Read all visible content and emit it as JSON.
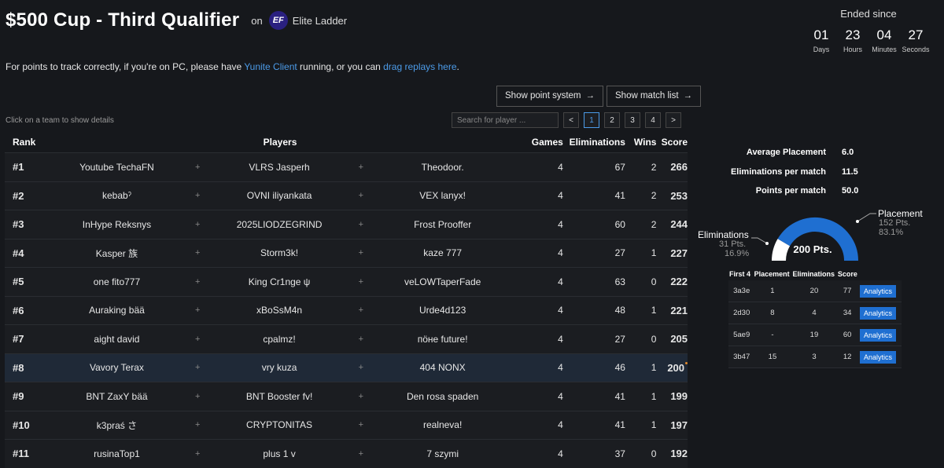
{
  "header": {
    "title": "$500 Cup - Third Qualifier",
    "on": "on",
    "ladder_logo": "EF",
    "ladder_name": "Elite Ladder"
  },
  "timer": {
    "title": "Ended since",
    "days": "01",
    "days_label": "Days",
    "hours": "23",
    "hours_label": "Hours",
    "minutes": "04",
    "minutes_label": "Minutes",
    "seconds": "27",
    "seconds_label": "Seconds"
  },
  "notice": {
    "part1": "For points to track correctly, if you're on PC, please have ",
    "link1": "Yunite Client",
    "part2": " running, or you can ",
    "link2": "drag replays here",
    "part3": "."
  },
  "buttons": {
    "point_system": "Show point system",
    "match_list": "Show match list"
  },
  "hint": "Click on a team to show details",
  "search": {
    "placeholder": "Search for player ..."
  },
  "pager": {
    "prev": "<",
    "next": ">",
    "pages": [
      "1",
      "2",
      "3",
      "4"
    ]
  },
  "table": {
    "headers": {
      "rank": "Rank",
      "players": "Players",
      "games": "Games",
      "elims": "Eliminations",
      "wins": "Wins",
      "score": "Score"
    },
    "plus": "+",
    "rows": [
      {
        "rank": "#1",
        "p1": "Youtube TechaFN",
        "p2": "VLRS Jasperh",
        "p3": "Theodoor.",
        "games": "4",
        "elims": "67",
        "wins": "2",
        "score": "266"
      },
      {
        "rank": "#2",
        "p1": "kebabˀ",
        "p2": "OVNI iliyankata",
        "p3": "VEX lanyx!",
        "games": "4",
        "elims": "41",
        "wins": "2",
        "score": "253"
      },
      {
        "rank": "#3",
        "p1": "InHype Reksnys",
        "p2": "2025LIODZEGRIND",
        "p3": "Frost Prooffer",
        "games": "4",
        "elims": "60",
        "wins": "2",
        "score": "244"
      },
      {
        "rank": "#4",
        "p1": "Kasper 族",
        "p2": "Storm3k!",
        "p3": "kaze 777",
        "games": "4",
        "elims": "27",
        "wins": "1",
        "score": "227"
      },
      {
        "rank": "#5",
        "p1": "one fito777",
        "p2": "King Cr1nge ψ",
        "p3": "veLOWTaperFade",
        "games": "4",
        "elims": "63",
        "wins": "0",
        "score": "222"
      },
      {
        "rank": "#6",
        "p1": "Auraking bää",
        "p2": "xBoSsM4n",
        "p3": "Urde4d123",
        "games": "4",
        "elims": "48",
        "wins": "1",
        "score": "221"
      },
      {
        "rank": "#7",
        "p1": "aight david",
        "p2": "cpalmz!",
        "p3": "пӧне future!",
        "games": "4",
        "elims": "27",
        "wins": "0",
        "score": "205"
      },
      {
        "rank": "#8",
        "p1": "Vavory Terax",
        "p2": "vry kuza",
        "p3": "404 NONX",
        "games": "4",
        "elims": "46",
        "wins": "1",
        "score": "200"
      },
      {
        "rank": "#9",
        "p1": "BNT ZaxY bää",
        "p2": "BNT Booster fv!",
        "p3": "Den rosa spaden",
        "games": "4",
        "elims": "41",
        "wins": "1",
        "score": "199"
      },
      {
        "rank": "#10",
        "p1": "k3praś さ",
        "p2": "CRYPTONITAS",
        "p3": "realneva!",
        "games": "4",
        "elims": "41",
        "wins": "1",
        "score": "197"
      },
      {
        "rank": "#11",
        "p1": "rusinaTop1",
        "p2": "plus 1 v",
        "p3": "7 szymi",
        "games": "4",
        "elims": "37",
        "wins": "0",
        "score": "192"
      }
    ]
  },
  "stats": {
    "avg_label": "Average Placement",
    "avg_value": "6.0",
    "epm_label": "Eliminations per match",
    "epm_value": "11.5",
    "ppm_label": "Points per match",
    "ppm_value": "50.0"
  },
  "gauge": {
    "total": "200 Pts.",
    "elims_label": "Eliminations",
    "elims_pts": "31 Pts.",
    "elims_pct": "16.9%",
    "place_label": "Placement",
    "place_pts": "152 Pts.",
    "place_pct": "83.1%",
    "elims_fraction": 0.169,
    "place_color": "#1f6fd1",
    "elims_color": "#ffffff"
  },
  "mini_table": {
    "headers": {
      "id": "First 4",
      "placement": "Placement",
      "elims": "Eliminations",
      "score": "Score"
    },
    "action_label": "Analytics",
    "rows": [
      {
        "id": "3a3e",
        "placement": "1",
        "elims": "20",
        "score": "77"
      },
      {
        "id": "2d30",
        "placement": "8",
        "elims": "4",
        "score": "34"
      },
      {
        "id": "5ae9",
        "placement": "-",
        "elims": "19",
        "score": "60"
      },
      {
        "id": "3b47",
        "placement": "15",
        "elims": "3",
        "score": "12"
      }
    ]
  }
}
